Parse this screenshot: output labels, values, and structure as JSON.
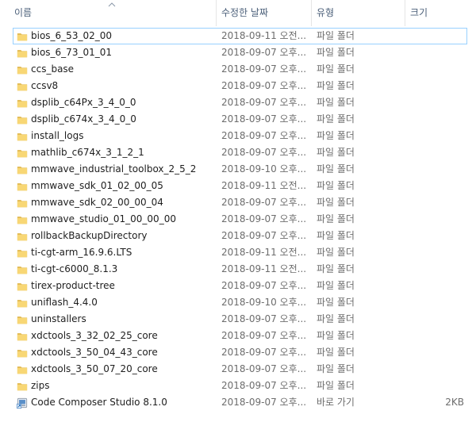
{
  "columns": {
    "name": "이름",
    "date": "수정한 날짜",
    "type": "유형",
    "size": "크기"
  },
  "colors": {
    "folder": "#f8d775",
    "folder_dark": "#e0b64c",
    "focus_border": "#99d1ff",
    "header_text": "#4c607a"
  },
  "rows": [
    {
      "name": "bios_6_53_02_00",
      "date": "2018-09-11 오전...",
      "type": "파일 폴더",
      "size": "",
      "icon": "folder-icon"
    },
    {
      "name": "bios_6_73_01_01",
      "date": "2018-09-07 오후...",
      "type": "파일 폴더",
      "size": "",
      "icon": "folder-icon"
    },
    {
      "name": "ccs_base",
      "date": "2018-09-07 오후...",
      "type": "파일 폴더",
      "size": "",
      "icon": "folder-icon"
    },
    {
      "name": "ccsv8",
      "date": "2018-09-07 오후...",
      "type": "파일 폴더",
      "size": "",
      "icon": "folder-icon"
    },
    {
      "name": "dsplib_c64Px_3_4_0_0",
      "date": "2018-09-07 오후...",
      "type": "파일 폴더",
      "size": "",
      "icon": "folder-icon"
    },
    {
      "name": "dsplib_c674x_3_4_0_0",
      "date": "2018-09-07 오후...",
      "type": "파일 폴더",
      "size": "",
      "icon": "folder-icon"
    },
    {
      "name": "install_logs",
      "date": "2018-09-07 오후...",
      "type": "파일 폴더",
      "size": "",
      "icon": "folder-icon"
    },
    {
      "name": "mathlib_c674x_3_1_2_1",
      "date": "2018-09-07 오후...",
      "type": "파일 폴더",
      "size": "",
      "icon": "folder-icon"
    },
    {
      "name": "mmwave_industrial_toolbox_2_5_2",
      "date": "2018-09-10 오후...",
      "type": "파일 폴더",
      "size": "",
      "icon": "folder-icon"
    },
    {
      "name": "mmwave_sdk_01_02_00_05",
      "date": "2018-09-11 오전...",
      "type": "파일 폴더",
      "size": "",
      "icon": "folder-icon"
    },
    {
      "name": "mmwave_sdk_02_00_00_04",
      "date": "2018-09-07 오후...",
      "type": "파일 폴더",
      "size": "",
      "icon": "folder-icon"
    },
    {
      "name": "mmwave_studio_01_00_00_00",
      "date": "2018-09-07 오후...",
      "type": "파일 폴더",
      "size": "",
      "icon": "folder-icon"
    },
    {
      "name": "rollbackBackupDirectory",
      "date": "2018-09-07 오후...",
      "type": "파일 폴더",
      "size": "",
      "icon": "folder-icon"
    },
    {
      "name": "ti-cgt-arm_16.9.6.LTS",
      "date": "2018-09-11 오전...",
      "type": "파일 폴더",
      "size": "",
      "icon": "folder-icon"
    },
    {
      "name": "ti-cgt-c6000_8.1.3",
      "date": "2018-09-11 오전...",
      "type": "파일 폴더",
      "size": "",
      "icon": "folder-icon"
    },
    {
      "name": "tirex-product-tree",
      "date": "2018-09-07 오후...",
      "type": "파일 폴더",
      "size": "",
      "icon": "folder-icon"
    },
    {
      "name": "uniflash_4.4.0",
      "date": "2018-09-10 오후...",
      "type": "파일 폴더",
      "size": "",
      "icon": "folder-icon"
    },
    {
      "name": "uninstallers",
      "date": "2018-09-07 오후...",
      "type": "파일 폴더",
      "size": "",
      "icon": "folder-icon"
    },
    {
      "name": "xdctools_3_32_02_25_core",
      "date": "2018-09-07 오후...",
      "type": "파일 폴더",
      "size": "",
      "icon": "folder-icon"
    },
    {
      "name": "xdctools_3_50_04_43_core",
      "date": "2018-09-07 오후...",
      "type": "파일 폴더",
      "size": "",
      "icon": "folder-icon"
    },
    {
      "name": "xdctools_3_50_07_20_core",
      "date": "2018-09-07 오후...",
      "type": "파일 폴더",
      "size": "",
      "icon": "folder-icon"
    },
    {
      "name": "zips",
      "date": "2018-09-07 오후...",
      "type": "파일 폴더",
      "size": "",
      "icon": "folder-icon"
    },
    {
      "name": "Code Composer Studio 8.1.0",
      "date": "2018-09-07 오후...",
      "type": "바로 가기",
      "size": "2KB",
      "icon": "shortcut-icon"
    }
  ]
}
